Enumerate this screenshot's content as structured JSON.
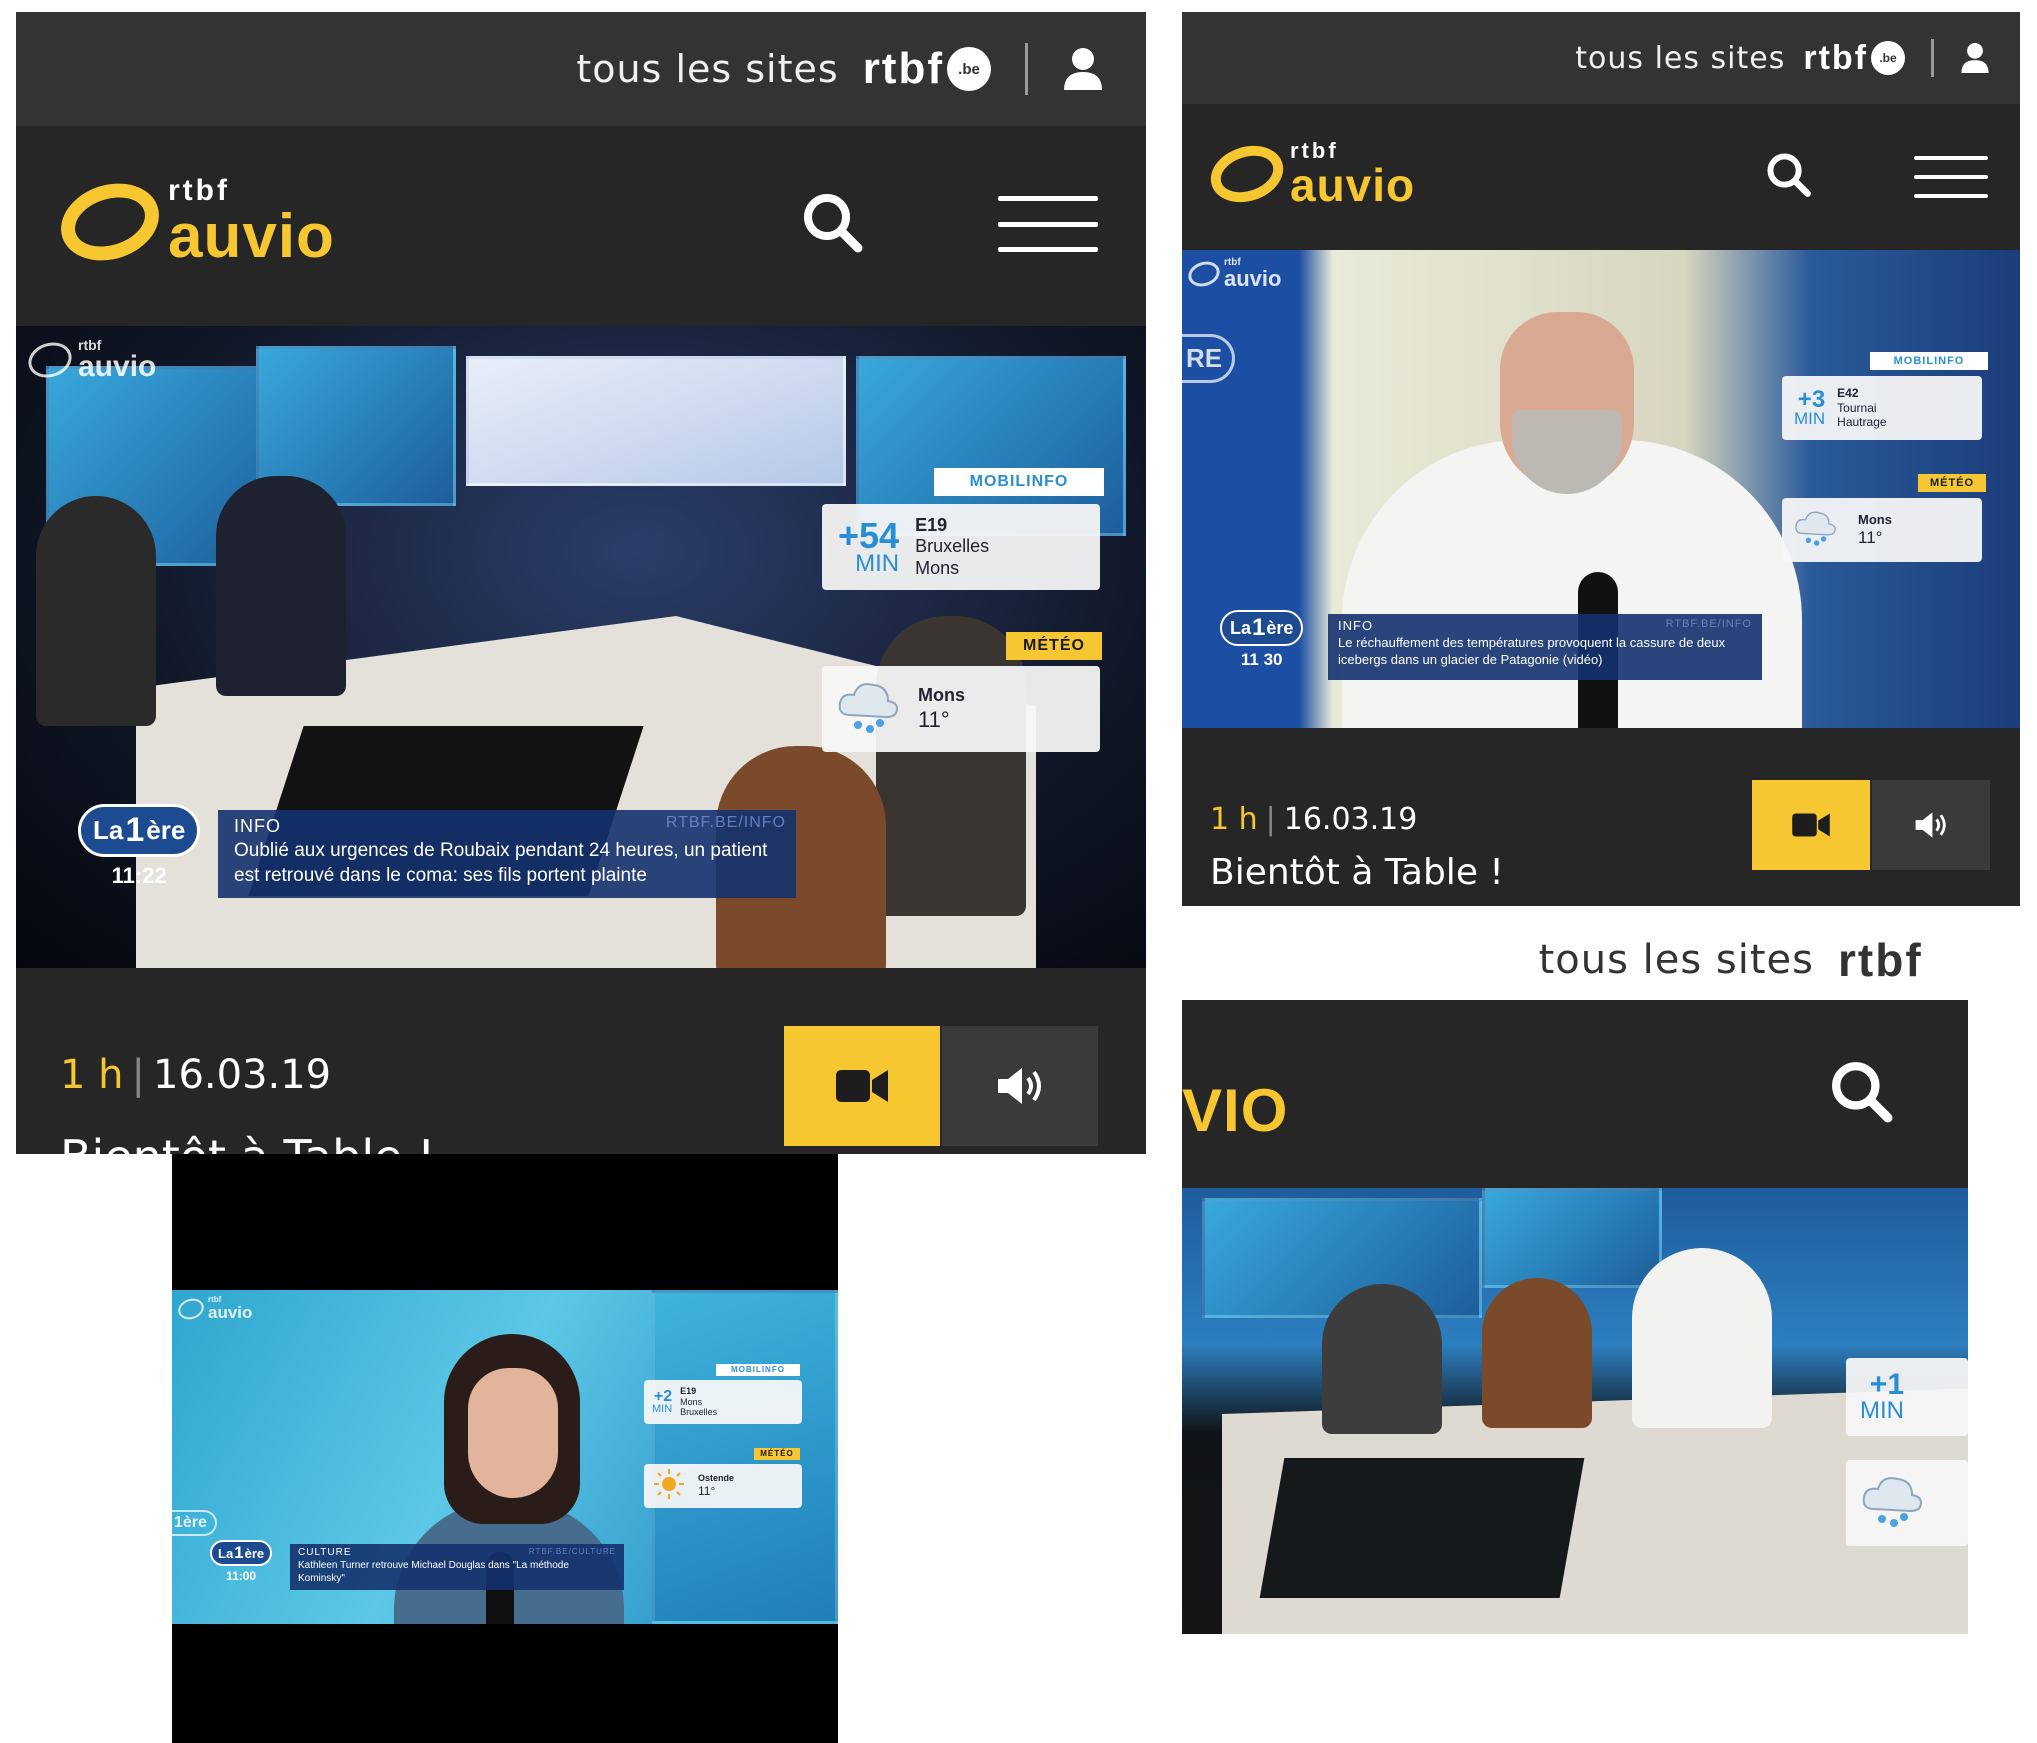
{
  "topbar": {
    "all_sites": "tous les sites",
    "brand": "rtbf",
    "brand_suffix": ".be"
  },
  "logo": {
    "small": "rtbf",
    "big": "auvio"
  },
  "watermark": {
    "small": "rtbf",
    "big": "auvio"
  },
  "program": {
    "duration": "1 h",
    "date": "16.03.19",
    "title": "Bientôt à Table !"
  },
  "media_buttons": {
    "video_icon": "video-camera-icon",
    "audio_icon": "speaker-icon"
  },
  "colors": {
    "accent": "#f7c731",
    "topbar": "#333333",
    "header": "#262626",
    "traffic_blue": "#2a8ed5",
    "ticker": "#14326e"
  },
  "screen1": {
    "mobilinfo_tag": "MOBILINFO",
    "traffic": {
      "plus": "+",
      "minutes": "54",
      "unit": "MIN",
      "road": "E19",
      "from": "Bruxelles",
      "to": "Mons"
    },
    "meteo_tag": "MÉTÉO",
    "weather": {
      "city": "Mons",
      "temp": "11°",
      "icon": "rain-cloud-icon"
    },
    "ticker": {
      "category": "INFO",
      "source": "RTBF.BE/INFO",
      "text": "Oublié aux urgences de Roubaix pendant 24 heures, un patient est retrouvé dans le coma: ses fils portent plainte"
    },
    "channel": {
      "la": "La",
      "one": "1",
      "ere": "ère",
      "time": "11:22"
    }
  },
  "screen2": {
    "mobilinfo_tag": "MOBILINFO",
    "traffic": {
      "plus": "+",
      "minutes": "3",
      "unit": "MIN",
      "road": "E42",
      "from": "Tournai",
      "to": "Hautrage"
    },
    "meteo_tag": "MÉTÉO",
    "weather": {
      "city": "Mons",
      "temp": "11°",
      "icon": "rain-cloud-icon"
    },
    "ticker": {
      "category": "INFO",
      "source": "RTBF.BE/INFO",
      "text": "Le réchauffement des températures provoquent la cassure de deux icebergs dans un glacier de Patagonie (vidéo)"
    },
    "channel": {
      "la": "La",
      "one": "1",
      "ere": "ère",
      "time": "11 30"
    },
    "side_text": "RE"
  },
  "screen3": {
    "mobilinfo_tag": "MOBILINFO",
    "traffic": {
      "plus": "+",
      "minutes": "2",
      "unit": "MIN",
      "road": "E19",
      "from": "Mons",
      "to": "Bruxelles"
    },
    "meteo_tag": "MÉTÉO",
    "weather": {
      "city": "Ostende",
      "temp": "11°",
      "icon": "sun-icon"
    },
    "ticker": {
      "category": "CULTURE",
      "source": "RTBF.BE/CULTURE",
      "text": "Kathleen Turner retrouve Michael Douglas dans \"La méthode Kominsky\""
    },
    "channel": {
      "la": "La",
      "one": "1",
      "ere": "ère",
      "time": "11:00"
    },
    "side_text": "1ère"
  },
  "screen4": {
    "logo_partial": "VIO",
    "brand_partial": "rtbf",
    "traffic": {
      "plus": "+",
      "minutes": "1",
      "unit": "MIN"
    }
  }
}
